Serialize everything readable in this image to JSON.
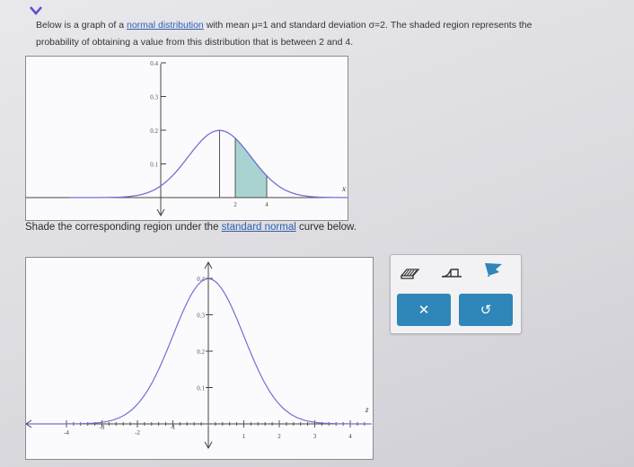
{
  "problem": {
    "line1_before": "Below is a graph of a ",
    "link_normal": "normal distribution",
    "line1_after": " with mean μ=1 and standard deviation σ=2. The shaded region represents the",
    "line2": "probability of obtaining a value from this distribution that is between 2 and 4.",
    "instruction_before": "Shade the corresponding region under the ",
    "link_standard": "standard normal",
    "instruction_after": " curve below."
  },
  "graph1": {
    "y_ticks": [
      "0.4",
      "0.3",
      "0.2",
      "0.1"
    ],
    "x_labels": [
      "2",
      "4"
    ],
    "axis_label": "x",
    "shaded_range": [
      2,
      4
    ],
    "shade_color": "#a9d3d0"
  },
  "graph2": {
    "y_ticks": [
      "0.4",
      "0.3",
      "0.2",
      "0.1"
    ],
    "x_labels": [
      "-4",
      "-3",
      "-2",
      "-1",
      "1",
      "2",
      "3",
      "4"
    ],
    "axis_label": "z"
  },
  "toolbox": {
    "tools": [
      "shade-region-tool",
      "interval-tool",
      "flag-tool"
    ],
    "clear_label": "✕",
    "undo_label": "↺"
  },
  "colors": {
    "curve": "#6f6fd8",
    "accent": "#2f86b8",
    "link": "#2f5fb0"
  }
}
